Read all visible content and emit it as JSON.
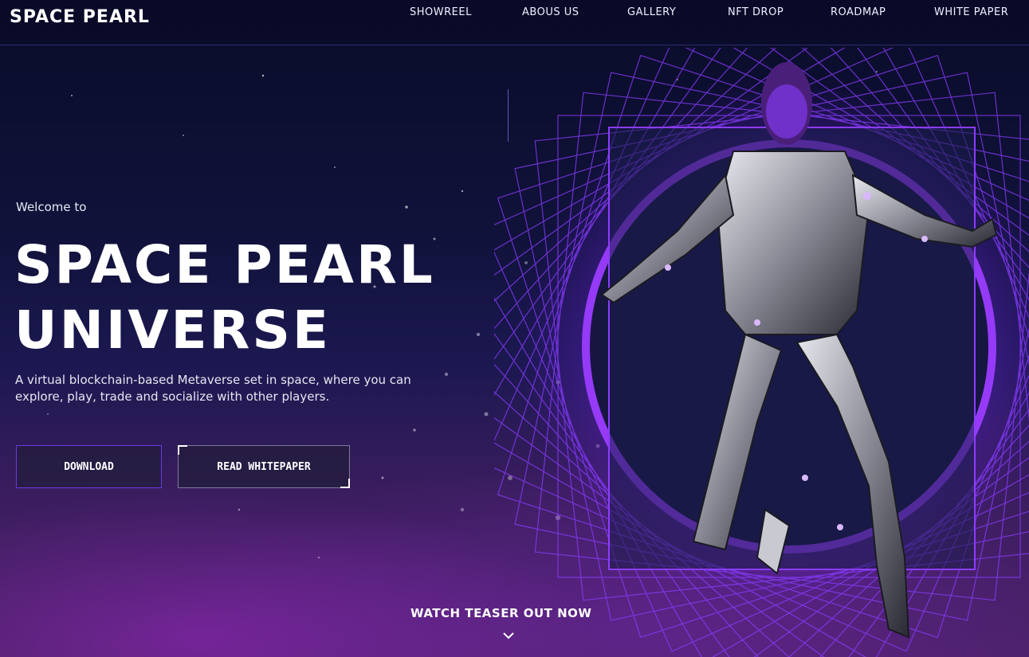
{
  "brand": {
    "name": "SPACE PEARL"
  },
  "nav": {
    "items": [
      {
        "label": "SHOWREEL"
      },
      {
        "label": "ABOUS US"
      },
      {
        "label": "GALLERY"
      },
      {
        "label": "NFT DROP"
      },
      {
        "label": "ROADMAP"
      },
      {
        "label": "WHITE PAPER"
      }
    ]
  },
  "hero": {
    "welcome": "Welcome to",
    "title_line1": "SPACE PEARL",
    "title_line2": "UNIVERSE",
    "description": "A virtual blockchain-based Metaverse set in space, where you can explore, play, trade and socialize with other players.",
    "download_label": "DOWNLOAD",
    "whitepaper_label": "READ WHITEPAPER",
    "teaser": "WATCH TEASER OUT NOW"
  },
  "colors": {
    "accent": "#7a2ff0",
    "background": "#0b0a24",
    "text": "#ffffff"
  },
  "icons": {
    "scroll": "chevron-down-icon"
  }
}
